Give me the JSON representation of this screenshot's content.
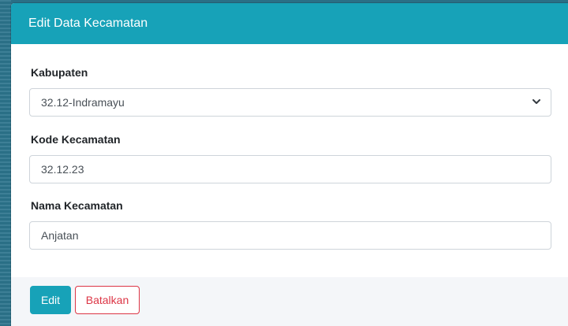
{
  "modal": {
    "title": "Edit Data Kecamatan"
  },
  "form": {
    "kabupaten": {
      "label": "Kabupaten",
      "selected": "32.12-Indramayu"
    },
    "kode_kecamatan": {
      "label": "Kode Kecamatan",
      "value": "32.12.23"
    },
    "nama_kecamatan": {
      "label": "Nama Kecamatan",
      "value": "Anjatan"
    }
  },
  "footer": {
    "edit_label": "Edit",
    "cancel_label": "Batalkan"
  },
  "colors": {
    "header": "#17a2b8",
    "edit_button": "#17a2b8",
    "cancel_button": "#dc3545"
  },
  "icons": {
    "select_arrow": "chevron-down-icon"
  }
}
